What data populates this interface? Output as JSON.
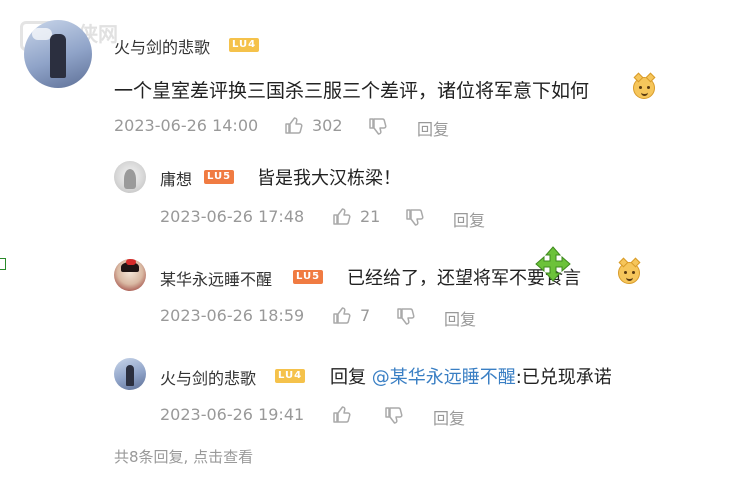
{
  "watermark": "游侠网",
  "main_comment": {
    "username": "火与剑的悲歌",
    "level": "LU4",
    "text": "一个皇室差评换三国杀三服三个差评，诸位将军意下如何",
    "date": "2023-06-26 14:00",
    "likes": "302",
    "reply_label": "回复"
  },
  "replies": [
    {
      "username": "庸想",
      "level": "LU5",
      "text": "皆是我大汉栋梁！",
      "date": "2023-06-26 17:48",
      "likes": "21",
      "reply_label": "回复"
    },
    {
      "username": "某华永远睡不醒",
      "level": "LU5",
      "text": "已经给了，还望将军不要食言",
      "date": "2023-06-26 18:59",
      "likes": "7",
      "reply_label": "回复"
    },
    {
      "username": "火与剑的悲歌",
      "level": "LU4",
      "reply_prefix": "回复",
      "mention": "@某华永远睡不醒",
      "text": ":已兑现承诺",
      "date": "2023-06-26 19:41",
      "likes": "",
      "reply_label": "回复"
    }
  ],
  "footer": "共8条回复, 点击查看",
  "icons": {
    "like": "thumbs-up-icon",
    "dislike": "thumbs-down-icon",
    "emoji": "doge-emoji-icon",
    "cursor": "move-cursor-icon"
  },
  "colors": {
    "lv4": "#f5c24b",
    "lv5": "#f07b42",
    "mention": "#3a7fc4",
    "meta": "#999999",
    "cursor": "#4caf2a"
  }
}
